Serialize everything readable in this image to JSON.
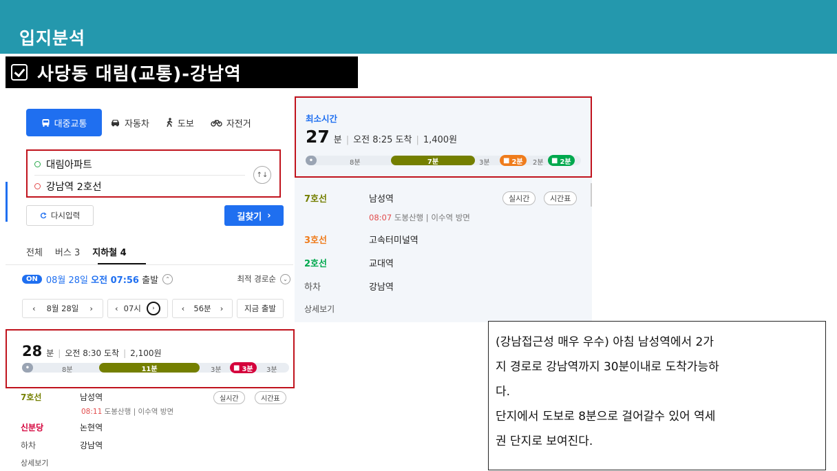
{
  "page_title": "입지분석",
  "route_title": "사당동 대림(교통)-강남역",
  "mode_tabs": [
    {
      "label": "대중교통",
      "icon": "bus-icon",
      "active": true
    },
    {
      "label": "자동차",
      "icon": "car-icon",
      "active": false
    },
    {
      "label": "도보",
      "icon": "walk-icon",
      "active": false
    },
    {
      "label": "자전거",
      "icon": "bicycle-icon",
      "active": false
    }
  ],
  "origin": "대림아파트",
  "destination": "강남역 2호선",
  "swap_label": "↑↓",
  "reset_label": "다시입력",
  "search_label": "길찾기",
  "result_tabs": [
    "전체",
    "버스 3",
    "지하철 4"
  ],
  "depart": {
    "badge": "ON",
    "date": "08월 28일",
    "time": "오전 07:56",
    "suffix": "출발",
    "sort": "최적 경로순"
  },
  "time_picker": {
    "date": "8월 28일",
    "hour": "07시",
    "minute": "56분",
    "now": "지금 출발"
  },
  "colors": {
    "accent_blue": "#1f6ff0",
    "line7": "#747f00",
    "line3": "#ef7c1c",
    "line2": "#00a84d",
    "shinbundang": "#d4003b",
    "highlight_red": "#c0121c",
    "header_teal": "#2498ad"
  },
  "route_best": {
    "label": "최소시간",
    "minutes": "27",
    "minute_unit": "분",
    "arrival": "오전 8:25 도착",
    "fare": "1,400원",
    "bar": {
      "walk1": "8분",
      "line7": "7분",
      "walk2": "3분",
      "line3": "2분",
      "walk3": "2분",
      "line2": "2분"
    },
    "steps": [
      {
        "line": "7호선",
        "station": "남성역",
        "depart_time": "08:07",
        "direction": "도봉산행",
        "next": "이수역 방면"
      },
      {
        "line": "3호선",
        "station": "고속터미널역"
      },
      {
        "line": "2호선",
        "station": "교대역"
      },
      {
        "line": "하차",
        "station": "강남역"
      }
    ],
    "btn_realtime": "실시간",
    "btn_timetable": "시간표",
    "detail": "상세보기"
  },
  "route_alt": {
    "minutes": "28",
    "minute_unit": "분",
    "arrival": "오전 8:30 도착",
    "fare": "2,100원",
    "bar": {
      "walk1": "8분",
      "line7": "11분",
      "walk2": "3분",
      "shin": "3분",
      "walk3": "3분"
    },
    "steps": [
      {
        "line": "7호선",
        "station": "남성역",
        "depart_time": "08:11",
        "direction": "도봉산행",
        "next": "이수역 방면"
      },
      {
        "line": "신분당",
        "station": "논현역"
      },
      {
        "line": "하차",
        "station": "강남역"
      }
    ],
    "btn_realtime": "실시간",
    "btn_timetable": "시간표",
    "detail": "상세보기"
  },
  "comment_lines": [
    "(강남접근성 매우 우수) 아침 남성역에서 2가",
    "지 경로로 강남역까지 30분이내로 도착가능하",
    "다.",
    "단지에서 도보로 8분으로 걸어갈수 있어 역세",
    "권 단지로 보여진다."
  ]
}
